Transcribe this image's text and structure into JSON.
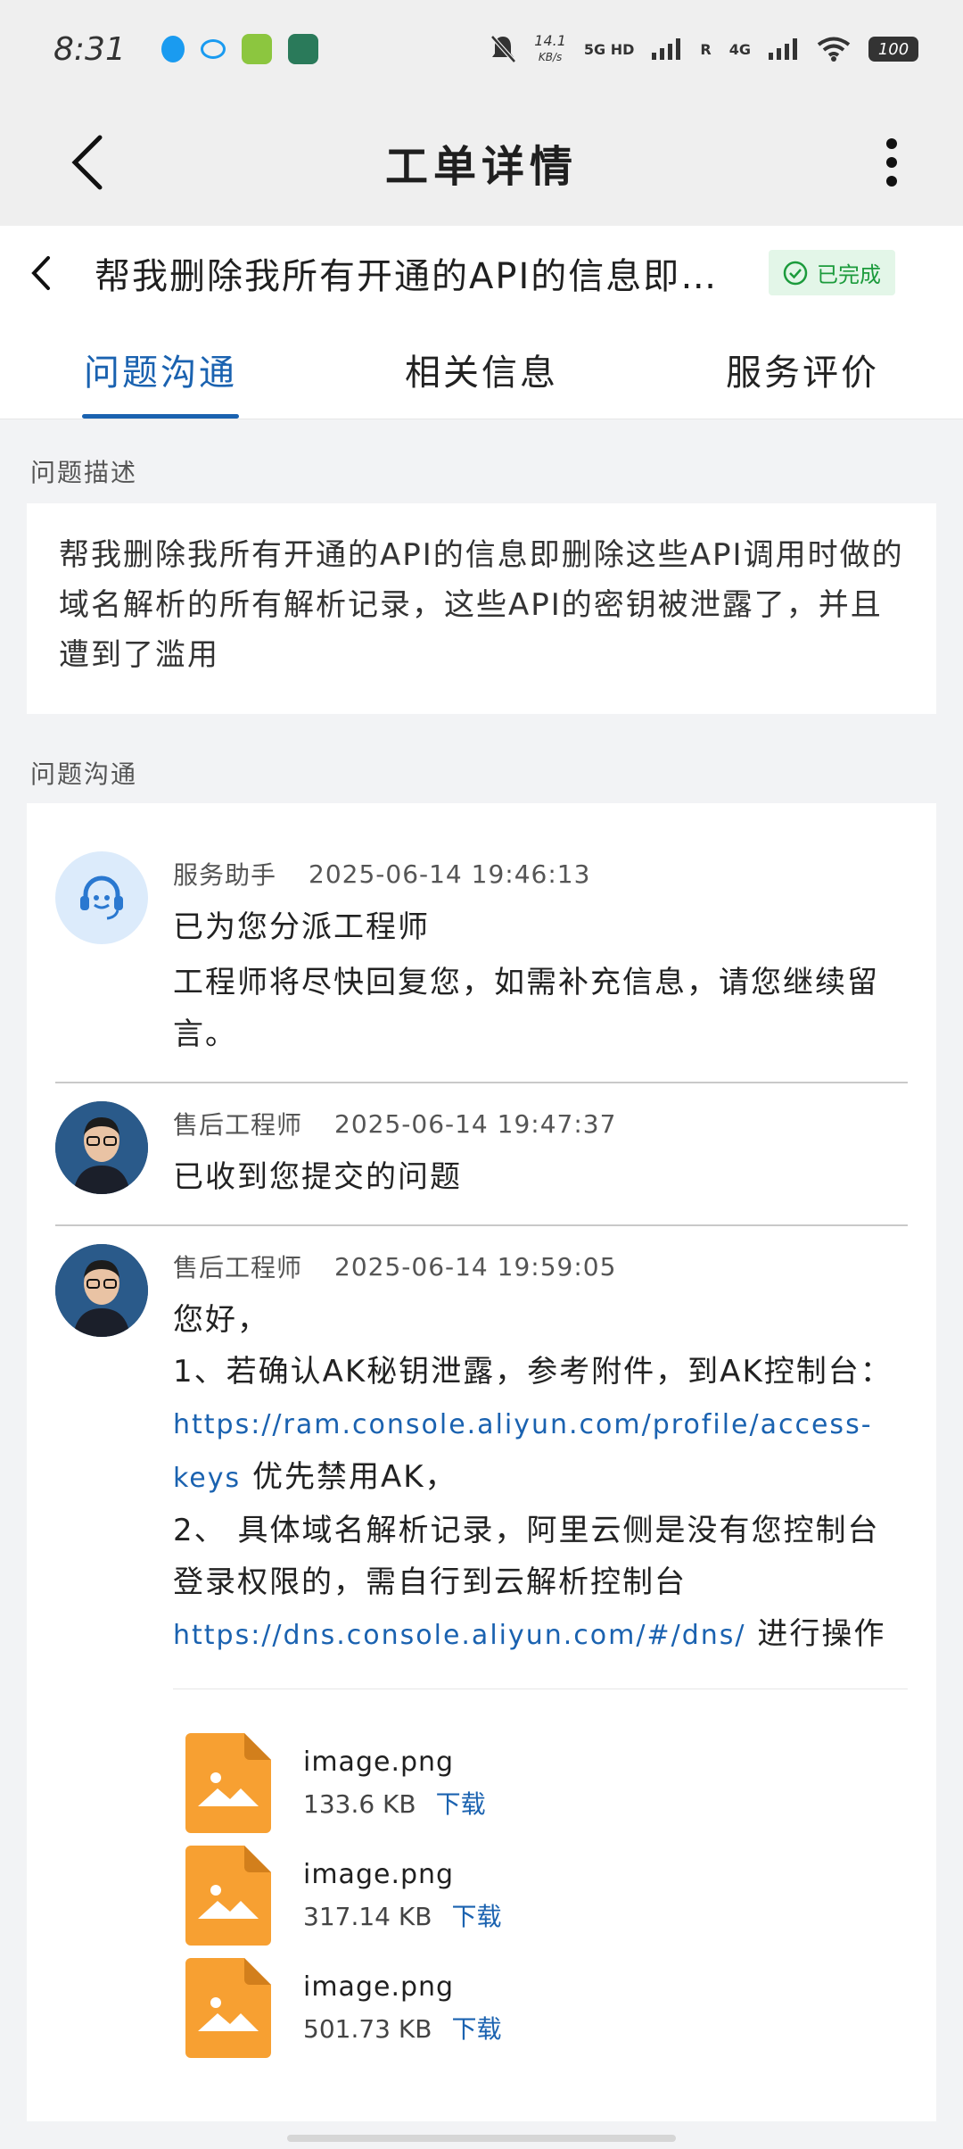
{
  "status_bar": {
    "time": "8:31",
    "speed": "14.1",
    "speed_unit": "KB/s",
    "net1": "5G HD",
    "net2": "4G",
    "roaming": "R",
    "battery": "100"
  },
  "header": {
    "title": "工单详情"
  },
  "ticket": {
    "title": "帮我删除我所有开通的API的信息即删除这些API调用时做的域名解析的所有解析记录",
    "status": "已完成"
  },
  "tabs": [
    {
      "label": "问题沟通",
      "active": true
    },
    {
      "label": "相关信息",
      "active": false
    },
    {
      "label": "服务评价",
      "active": false
    }
  ],
  "description": {
    "section_label": "问题描述",
    "text": "帮我删除我所有开通的API的信息即删除这些API调用时做的域名解析的所有解析记录，这些API的密钥被泄露了，并且遭到了滥用"
  },
  "communication": {
    "section_label": "问题沟通",
    "messages": [
      {
        "sender": "服务助手",
        "time": "2025-06-14 19:46:13",
        "line1": "已为您分派工程师",
        "line2": "工程师将尽快回复您，如需补充信息，请您继续留言。"
      },
      {
        "sender": "售后工程师",
        "time": "2025-06-14 19:47:37",
        "line1": "已收到您提交的问题"
      },
      {
        "sender": "售后工程师",
        "time": "2025-06-14 19:59:05",
        "greeting": "您好，",
        "p1_prefix": "1、若确认AK秘钥泄露，参考附件，到AK控制台：",
        "p1_link": "https://ram.console.aliyun.com/profile/access-keys",
        "p1_suffix": " 优先禁用AK，",
        "p2_prefix": "2、 具体域名解析记录，阿里云侧是没有您控制台登录权限的，需自行到云解析控制台",
        "p2_link": "https://dns.console.aliyun.com/#/dns/",
        "p2_suffix": " 进行操作",
        "attachments": [
          {
            "name": "image.png",
            "size": "133.6 KB",
            "action": "下载"
          },
          {
            "name": "image.png",
            "size": "317.14 KB",
            "action": "下载"
          },
          {
            "name": "image.png",
            "size": "501.73 KB",
            "action": "下载"
          }
        ]
      }
    ]
  },
  "colors": {
    "accent": "#1a62b0",
    "success": "#1c9b3c",
    "file_icon": "#f7a032"
  }
}
